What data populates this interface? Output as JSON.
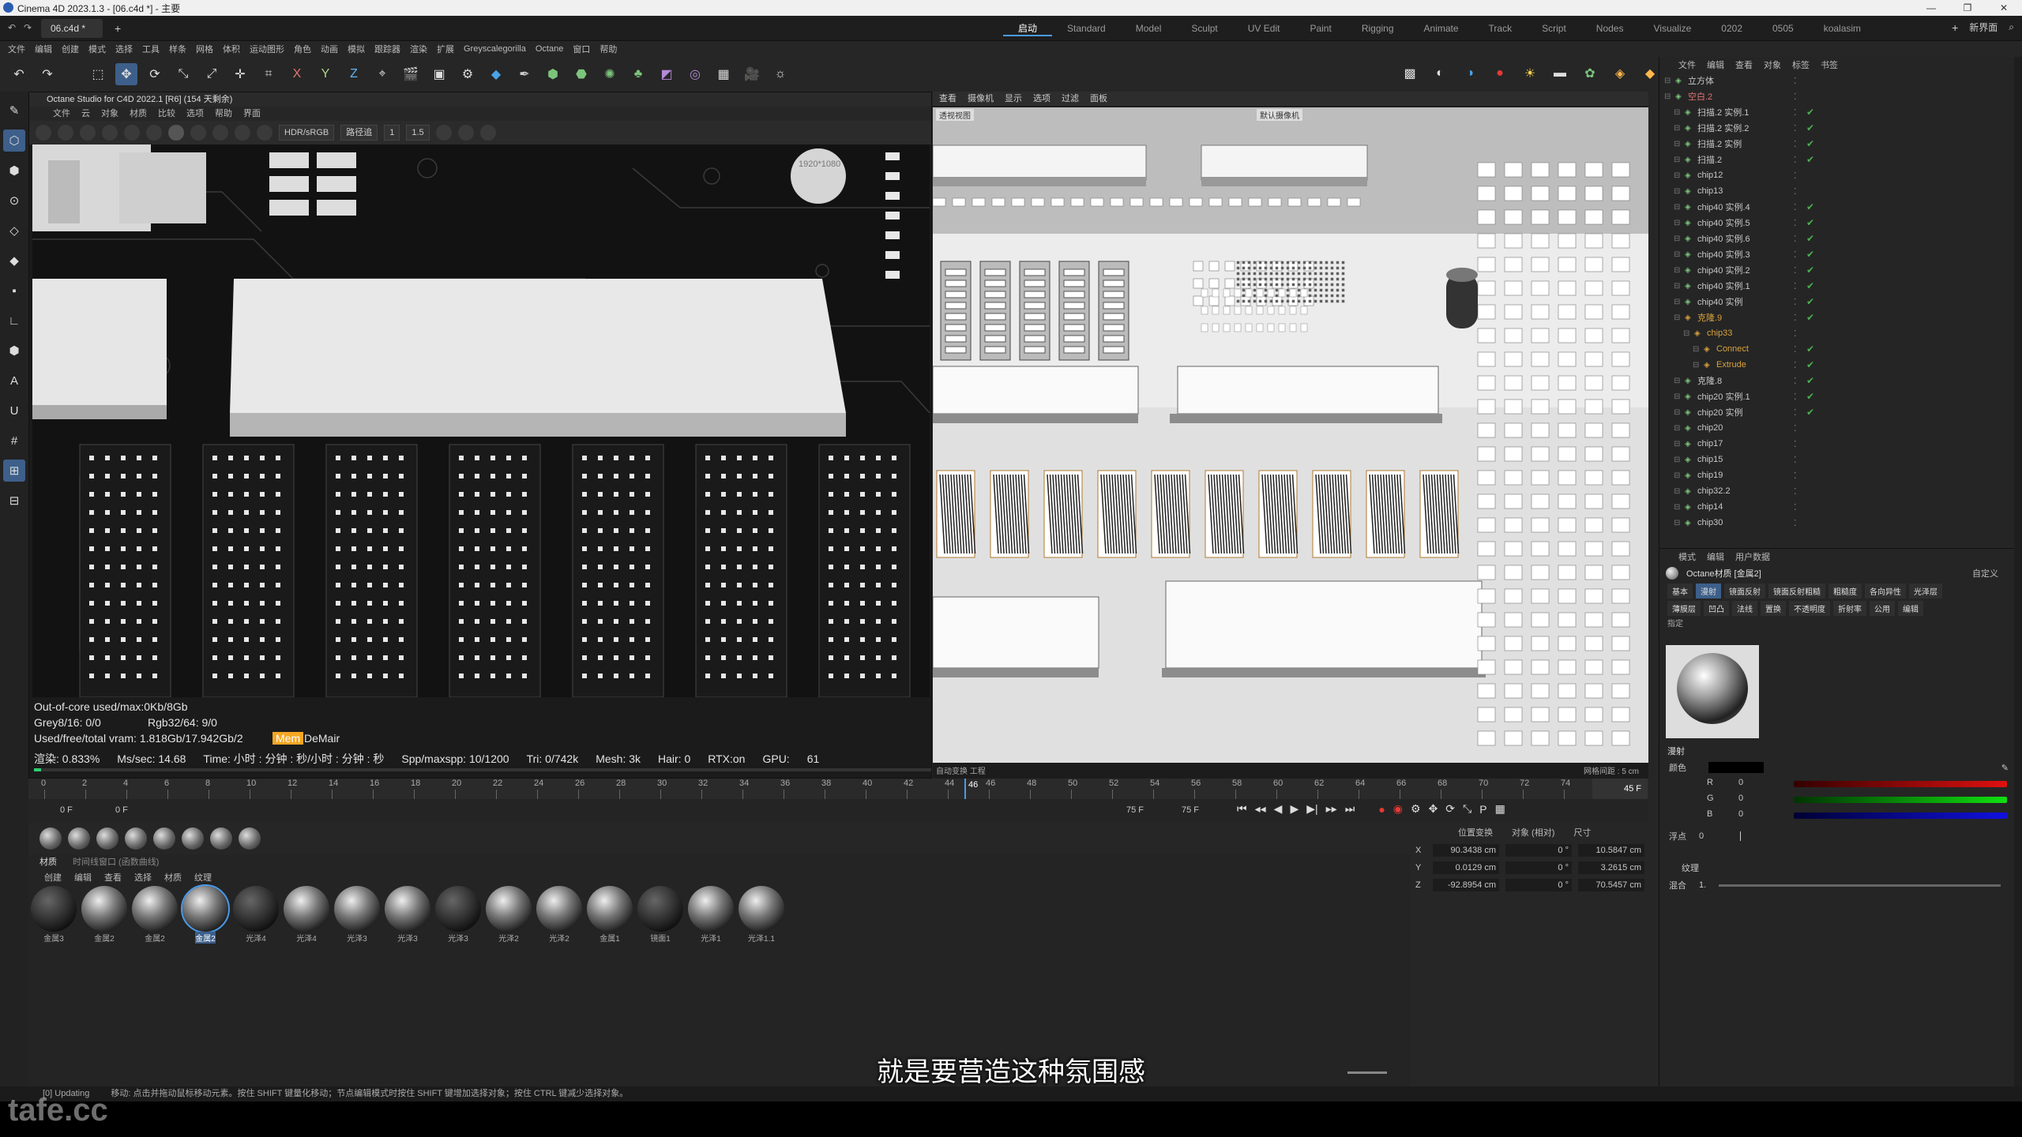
{
  "window": {
    "title": "Cinema 4D 2023.1.3 - [06.c4d *] - 主要",
    "controls": [
      "—",
      "❐",
      "✕"
    ]
  },
  "doc_tab": {
    "name": "06.c4d *",
    "add": "+"
  },
  "layouts": [
    "启动",
    "Standard",
    "Model",
    "Sculpt",
    "UV Edit",
    "Paint",
    "Rigging",
    "Animate",
    "Track",
    "Script",
    "Nodes",
    "Visualize",
    "0202",
    "0505",
    "koalasim"
  ],
  "layouts_right": {
    "plus": "+",
    "new_layout": "新界面"
  },
  "menu": [
    "文件",
    "编辑",
    "创建",
    "模式",
    "选择",
    "工具",
    "样条",
    "网格",
    "体积",
    "运动图形",
    "角色",
    "动画",
    "模拟",
    "跟踪器",
    "渲染",
    "扩展",
    "Greyscalegorilla",
    "Octane",
    "窗口",
    "帮助"
  ],
  "octane": {
    "title": "Octane Studio for C4D 2022.1 [R6] (154 天剩余)",
    "menu": [
      "文件",
      "云",
      "对象",
      "材质",
      "比较",
      "选项",
      "帮助",
      "界面"
    ],
    "hdr": "HDR/sRGB",
    "mode": "路径追",
    "val1": "1",
    "val2": "1.5",
    "res": "1920*1080",
    "stats": {
      "l1": "Out-of-core used/max:0Kb/8Gb",
      "l2a": "Grey8/16: 0/0",
      "l2b": "Rgb32/64: 9/0",
      "l3": "Used/free/total vram: 1.818Gb/17.942Gb/2",
      "l3b": "Mem",
      "l3c": "DeMair",
      "l4": [
        "渲染: 0.833%",
        "Ms/sec: 14.68",
        "Time: 小时 : 分钟 : 秒/小时 : 分钟 : 秒",
        "Spp/maxspp: 10/1200",
        "Tri: 0/742k",
        "Mesh: 3k",
        "Hair: 0",
        "RTX:on",
        "GPU:",
        "61"
      ]
    },
    "progress": 0.00833
  },
  "viewport": {
    "menu": [
      "查看",
      "摄像机",
      "显示",
      "选项",
      "过滤",
      "面板"
    ],
    "label": "透视视图",
    "camera": "默认摄像机",
    "bottom_left": "自动变换  工程",
    "grid": "网格间距 : 5 cm"
  },
  "timeline": {
    "ticks": [
      "0",
      "2",
      "4",
      "6",
      "8",
      "10",
      "12",
      "14",
      "16",
      "18",
      "20",
      "22",
      "24",
      "26",
      "28",
      "30",
      "32",
      "34",
      "36",
      "38",
      "40",
      "42",
      "44",
      "46",
      "48",
      "50",
      "52",
      "54",
      "56",
      "58",
      "60",
      "62",
      "64",
      "66",
      "68",
      "70",
      "72",
      "74"
    ],
    "start": "0 F",
    "start2": "0 F",
    "end": "75 F",
    "end2": "75 F",
    "current": "45 F",
    "marker": "46"
  },
  "materials": {
    "tabs": [
      "材质",
      "时间线窗口 (函数曲线)"
    ],
    "menu": [
      "创建",
      "编辑",
      "查看",
      "选择",
      "材质",
      "纹理"
    ],
    "items": [
      "金属3",
      "金属2",
      "金属2",
      "金属2",
      "光泽4",
      "光泽4",
      "光泽3",
      "光泽3",
      "光泽3",
      "光泽2",
      "光泽2",
      "金属1",
      "镜面1",
      "光泽1",
      "光泽1.1"
    ]
  },
  "coords": {
    "head": [
      "位置变换",
      "对象 (相对)",
      "尺寸"
    ],
    "rows": [
      [
        "X",
        "90.3438 cm",
        "0 °",
        "10.5847 cm"
      ],
      [
        "Y",
        "0.0129 cm",
        "0 °",
        "3.2615 cm"
      ],
      [
        "Z",
        "-92.8954 cm",
        "0 °",
        "70.5457 cm"
      ]
    ]
  },
  "objects": {
    "menu": [
      "文件",
      "编辑",
      "查看",
      "对象",
      "标签",
      "书签"
    ],
    "items": [
      {
        "name": "立方体",
        "indent": 0,
        "check": false
      },
      {
        "name": "空白.2",
        "indent": 0,
        "check": false,
        "red": true
      },
      {
        "name": "扫描.2 实例.1",
        "indent": 1,
        "check": true
      },
      {
        "name": "扫描.2 实例.2",
        "indent": 1,
        "check": true
      },
      {
        "name": "扫描.2 实例",
        "indent": 1,
        "check": true
      },
      {
        "name": "扫描.2",
        "indent": 1,
        "check": true
      },
      {
        "name": "chip12",
        "indent": 1,
        "check": false
      },
      {
        "name": "chip13",
        "indent": 1,
        "check": false
      },
      {
        "name": "chip40 实例.4",
        "indent": 1,
        "check": true
      },
      {
        "name": "chip40 实例.5",
        "indent": 1,
        "check": true
      },
      {
        "name": "chip40 实例.6",
        "indent": 1,
        "check": true
      },
      {
        "name": "chip40 实例.3",
        "indent": 1,
        "check": true
      },
      {
        "name": "chip40 实例.2",
        "indent": 1,
        "check": true
      },
      {
        "name": "chip40 实例.1",
        "indent": 1,
        "check": true
      },
      {
        "name": "chip40 实例",
        "indent": 1,
        "check": true
      },
      {
        "name": "克隆.9",
        "indent": 1,
        "check": true,
        "orange": true
      },
      {
        "name": "chip33",
        "indent": 2,
        "check": false,
        "orange": true
      },
      {
        "name": "Connect",
        "indent": 3,
        "check": true,
        "orange": true
      },
      {
        "name": "Extrude",
        "indent": 3,
        "check": true,
        "orange": true
      },
      {
        "name": "克隆.8",
        "indent": 1,
        "check": true
      },
      {
        "name": "chip20 实例.1",
        "indent": 1,
        "check": true
      },
      {
        "name": "chip20 实例",
        "indent": 1,
        "check": true
      },
      {
        "name": "chip20",
        "indent": 1,
        "check": false
      },
      {
        "name": "chip17",
        "indent": 1,
        "check": false
      },
      {
        "name": "chip15",
        "indent": 1,
        "check": false
      },
      {
        "name": "chip19",
        "indent": 1,
        "check": false
      },
      {
        "name": "chip32.2",
        "indent": 1,
        "check": false
      },
      {
        "name": "chip14",
        "indent": 1,
        "check": false
      },
      {
        "name": "chip30",
        "indent": 1,
        "check": false
      }
    ]
  },
  "attributes": {
    "menu": [
      "模式",
      "编辑",
      "用户数据"
    ],
    "material": "Octane材质 [金属2]",
    "preset": "自定义",
    "tabs1": [
      "基本",
      "漫射",
      "镜面反射",
      "镜面反射粗糙",
      "粗糙度",
      "各向异性",
      "光泽层"
    ],
    "tabs2": [
      "薄膜层",
      "凹凸",
      "法线",
      "置换",
      "不透明度",
      "折射率",
      "公用",
      "编辑"
    ],
    "section": "指定",
    "diffuse": "漫射",
    "color_label": "颜色",
    "r": "0",
    "g": "0",
    "b": "0",
    "float_label": "浮点",
    "float_val": "0",
    "tex_label": "纹理",
    "mix_label": "混合",
    "mix_val": "1.",
    "R": "R",
    "G": "G",
    "B": "B"
  },
  "status": "移动: 点击并拖动鼠标移动元素。按住 SHIFT 键量化移动；节点编辑模式时按住 SHIFT 键增加选择对象；按住 CTRL 键减少选择对象。",
  "status_prefix": "[0] Updating",
  "subtitle": "就是要营造这种氛围感",
  "watermark": "tafe.cc"
}
